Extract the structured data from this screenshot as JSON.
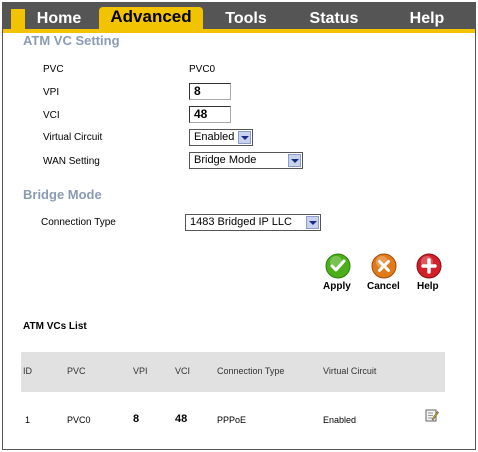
{
  "tabs": [
    "Home",
    "Advanced",
    "Tools",
    "Status",
    "Help"
  ],
  "atm": {
    "title": "ATM VC Setting",
    "pvc_label": "PVC",
    "pvc_value": "PVC0",
    "vpi_label": "VPI",
    "vpi_value": "8",
    "vci_label": "VCI",
    "vci_value": "48",
    "vc_label": "Virtual Circuit",
    "vc_value": "Enabled",
    "wan_label": "WAN Setting",
    "wan_value": "Bridge Mode"
  },
  "bridge": {
    "title": "Bridge Mode",
    "conn_label": "Connection Type",
    "conn_value": "1483 Bridged IP LLC"
  },
  "buttons": {
    "apply": "Apply",
    "cancel": "Cancel",
    "help": "Help"
  },
  "list": {
    "title": "ATM VCs List",
    "headers": [
      "ID",
      "PVC",
      "VPI",
      "VCI",
      "Connection Type",
      "Virtual Circuit"
    ],
    "rows": [
      {
        "id": "1",
        "pvc": "PVC0",
        "vpi": "8",
        "vci": "48",
        "conn": "PPPoE",
        "vc": "Enabled"
      }
    ]
  },
  "colors": {
    "tab_bar": "#555555",
    "accent": "#f2c300",
    "section_title": "#8a9bb3",
    "apply": "#4caf1a",
    "cancel": "#e07a1a",
    "help": "#d0202a"
  }
}
